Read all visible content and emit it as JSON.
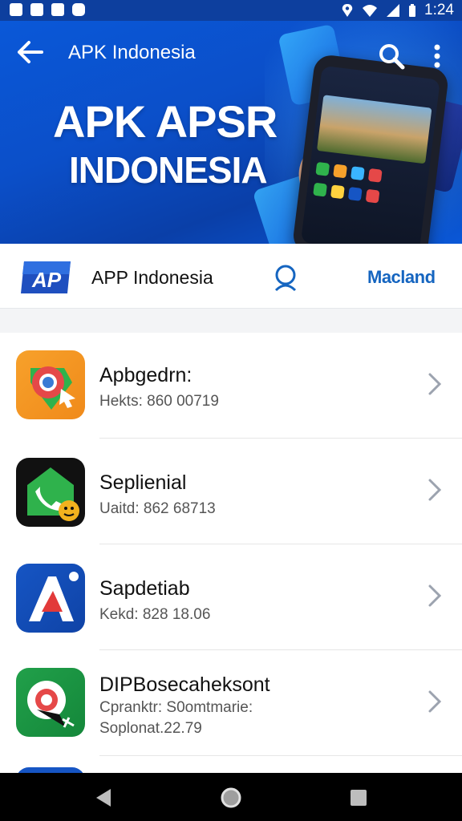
{
  "status_bar": {
    "time": "1:24",
    "left_icons": [
      "gallery-icon",
      "image-icon",
      "download-icon",
      "notification-icon"
    ],
    "right_icons": [
      "location-icon",
      "wifi-icon",
      "signal-icon",
      "battery-icon"
    ]
  },
  "app_bar": {
    "title": "APK Indonesia",
    "back_icon": "arrow-left-icon",
    "search_icon": "search-icon",
    "menu_icon": "more-vertical-icon"
  },
  "hero": {
    "line1": "APK APSR",
    "line2": "INDONESIA"
  },
  "sub_header": {
    "logo_text": "AP",
    "title": "APP Indonesia",
    "search_icon": "search-icon",
    "link_label": "Macland"
  },
  "list": {
    "items": [
      {
        "title": "Apbgedrn:",
        "subtitle": "Hekts: 860 00719",
        "icon": "chrome-maps-icon",
        "icon_colors": [
          "#f7a12b",
          "#f08a1a"
        ]
      },
      {
        "title": "Seplienial",
        "subtitle": "Uaitd: 862 68713",
        "icon": "phone-icon",
        "icon_colors": [
          "#2fb24c",
          "#1e9a3c"
        ]
      },
      {
        "title": "Sapdetiab",
        "subtitle": "Kekd: 828 18.06",
        "icon": "letter-a-icon",
        "icon_colors": [
          "#1655c4",
          "#0f43a6"
        ]
      },
      {
        "title": "DIPBosecaheksont",
        "subtitle": "Cpranktr: S0omtmarie:",
        "subtitle2": "Soplonat.22.79",
        "icon": "maps-pin-icon",
        "icon_colors": [
          "#21a04a",
          "#14873a"
        ]
      }
    ],
    "chevron_icon": "chevron-right-icon"
  },
  "nav_bar": {
    "back_icon": "nav-back-icon",
    "home_icon": "nav-home-icon",
    "recents_icon": "nav-recents-icon"
  },
  "colors": {
    "status_bar": "#0d3f9e",
    "hero_blue": "#0a58d8",
    "link_blue": "#1565c0",
    "nav_bar": "#000000"
  }
}
